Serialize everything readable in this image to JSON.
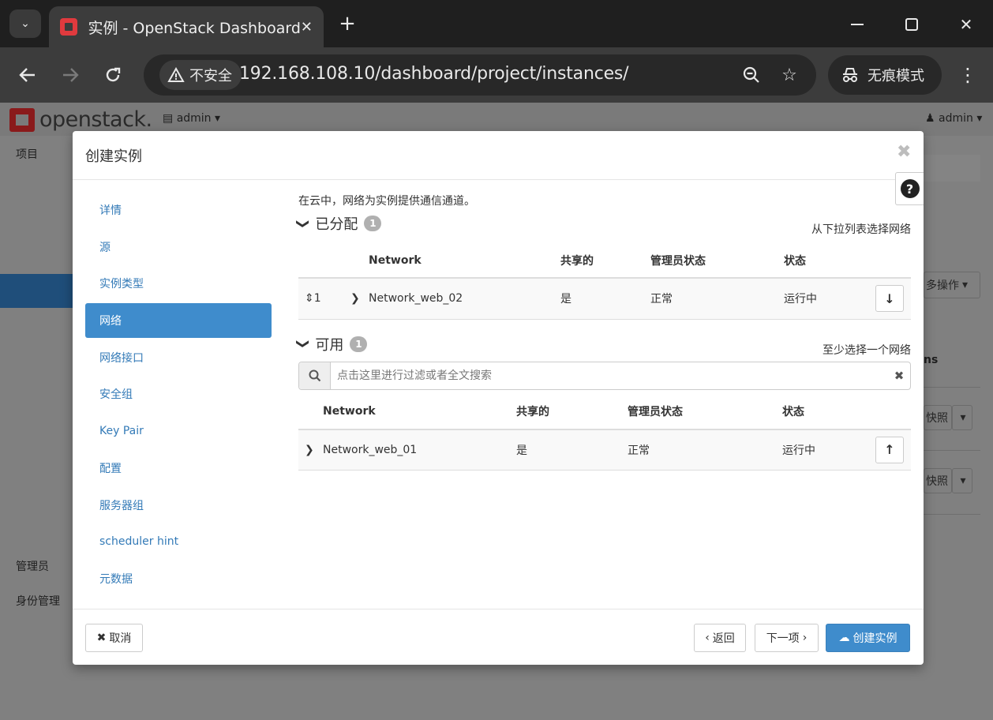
{
  "browser": {
    "tab_title": "实例 - OpenStack Dashboard",
    "security_label": "不安全",
    "url": "192.168.108.10/dashboard/project/instances/",
    "incognito_label": "无痕模式"
  },
  "page": {
    "logo_text": "openstack.",
    "project_selector": "admin",
    "user_menu": "admin",
    "sidebar": {
      "project": "项目",
      "admin": "管理员",
      "identity": "身份管理"
    },
    "bg_more_actions": "多操作",
    "bg_snapshot_1": "快照",
    "bg_snapshot_2": "快照",
    "bg_partial_text": "ns"
  },
  "modal": {
    "title": "创建实例",
    "wizard_steps": [
      {
        "label": "详情",
        "active": false
      },
      {
        "label": "源",
        "active": false
      },
      {
        "label": "实例类型",
        "active": false
      },
      {
        "label": "网络",
        "active": true
      },
      {
        "label": "网络接口",
        "active": false
      },
      {
        "label": "安全组",
        "active": false
      },
      {
        "label": "Key Pair",
        "active": false
      },
      {
        "label": "配置",
        "active": false
      },
      {
        "label": "服务器组",
        "active": false
      },
      {
        "label": "scheduler hint",
        "active": false
      },
      {
        "label": "元数据",
        "active": false
      }
    ],
    "intro": "在云中，网络为实例提供通信通道。",
    "allocated": {
      "title": "已分配",
      "count": "1",
      "hint": "从下拉列表选择网络",
      "columns": [
        "Network",
        "共享的",
        "管理员状态",
        "状态"
      ],
      "rows": [
        {
          "order": "1",
          "network": "Network_web_02",
          "shared": "是",
          "admin_state": "正常",
          "status": "运行中"
        }
      ]
    },
    "available": {
      "title": "可用",
      "count": "1",
      "hint": "至少选择一个网络",
      "search_placeholder": "点击这里进行过滤或者全文搜索",
      "columns": [
        "Network",
        "共享的",
        "管理员状态",
        "状态"
      ],
      "rows": [
        {
          "network": "Network_web_01",
          "shared": "是",
          "admin_state": "正常",
          "status": "运行中"
        }
      ]
    },
    "footer": {
      "cancel": "取消",
      "back": "返回",
      "next": "下一项",
      "create": "创建实例"
    }
  }
}
